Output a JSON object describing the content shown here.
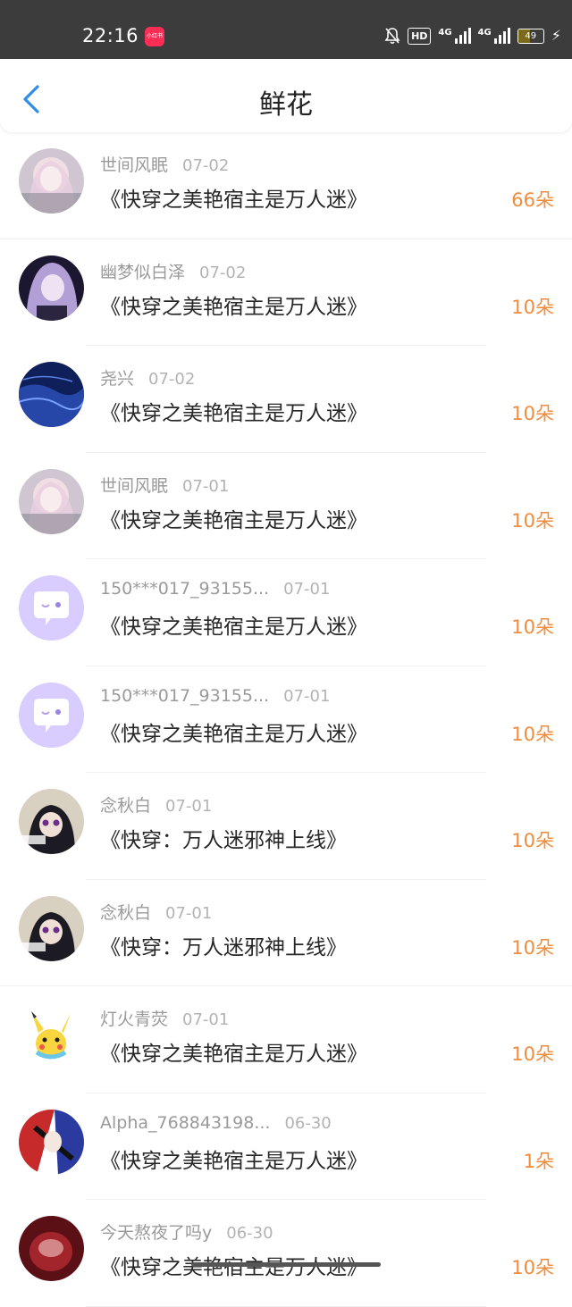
{
  "status_bar": {
    "time": "22:16",
    "app_badge": "小红书",
    "hd": "HD",
    "net1": "4G",
    "net2": "4G",
    "battery": "49",
    "battery_level": 0.49
  },
  "header": {
    "title": "鲜花"
  },
  "colors": {
    "flower_count": "#f28c3c",
    "username": "#9a9a9a",
    "title_text": "#262626"
  },
  "records": [
    {
      "user": "世间风眠",
      "date": "07-02",
      "book": "《快穿之美艳宿主是万人迷》",
      "count": "66朵",
      "avatar": "anime-girl-pink"
    },
    {
      "user": "幽梦似白泽",
      "date": "07-02",
      "book": "《快穿之美艳宿主是万人迷》",
      "count": "10朵",
      "avatar": "anime-girl-purple"
    },
    {
      "user": "尧兴",
      "date": "07-02",
      "book": "《快穿之美艳宿主是万人迷》",
      "count": "10朵",
      "avatar": "blue-ocean"
    },
    {
      "user": "世间风眠",
      "date": "07-01",
      "book": "《快穿之美艳宿主是万人迷》",
      "count": "10朵",
      "avatar": "anime-girl-pink"
    },
    {
      "user": "150***017_93155...",
      "date": "07-01",
      "book": "《快穿之美艳宿主是万人迷》",
      "count": "10朵",
      "avatar": "default-chat"
    },
    {
      "user": "150***017_93155...",
      "date": "07-01",
      "book": "《快穿之美艳宿主是万人迷》",
      "count": "10朵",
      "avatar": "default-chat"
    },
    {
      "user": "念秋白",
      "date": "07-01",
      "book": "《快穿：万人迷邪神上线》",
      "count": "10朵",
      "avatar": "anime-boy-dark"
    },
    {
      "user": "念秋白",
      "date": "07-01",
      "book": "《快穿：万人迷邪神上线》",
      "count": "10朵",
      "avatar": "anime-boy-dark"
    },
    {
      "user": "灯火青荧",
      "date": "07-01",
      "book": "《快穿之美艳宿主是万人迷》",
      "count": "10朵",
      "avatar": "pikachu"
    },
    {
      "user": "Alpha_768843198...",
      "date": "06-30",
      "book": "《快穿之美艳宿主是万人迷》",
      "count": "1朵",
      "avatar": "anime-red-blue"
    },
    {
      "user": "今天熬夜了吗y",
      "date": "06-30",
      "book": "《快穿之美艳宿主是万人迷》",
      "count": "10朵",
      "avatar": "red-photo"
    }
  ]
}
